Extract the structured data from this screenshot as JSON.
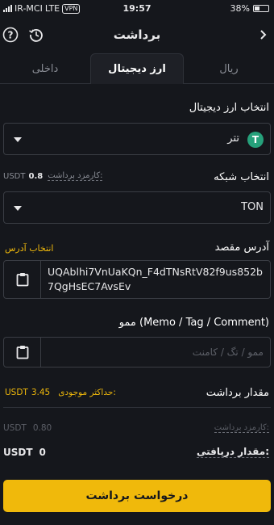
{
  "status_bar": {
    "carrier": "IR-MCI",
    "network": "LTE",
    "vpn": "VPN",
    "time": "19:57",
    "battery": "38%"
  },
  "header": {
    "title": "برداشت",
    "back_icon": "chevron-right-icon",
    "history_icon": "history-icon",
    "help_icon": "help-icon"
  },
  "tabs": [
    {
      "label": "ریال",
      "active": false
    },
    {
      "label": "ارز دیجیتال",
      "active": true
    },
    {
      "label": "داخلی",
      "active": false
    }
  ],
  "currency": {
    "label": "انتخاب ارز دیجیتال",
    "value": "تتر",
    "coin_symbol": "T"
  },
  "network": {
    "label": "انتخاب شبکه",
    "fee_label": "کارمزد برداشت:",
    "fee_value": "0.8",
    "fee_unit": "USDT",
    "value": "TON"
  },
  "address": {
    "label": "آدرس مقصد",
    "select_link": "انتخاب آدرس",
    "value": "UQAblhi7VnUaKQn_F4dTNsRtV82f9us852b7QgHsEC7AvsEv"
  },
  "memo": {
    "label": "ممو (Memo / Tag / Comment)",
    "placeholder": "ممو / تگ / کامنت"
  },
  "amount": {
    "label": "مقدار برداشت",
    "max_label": "حداکثر موجودی:",
    "max_value": "3.45",
    "max_unit": "USDT",
    "fee_label": "کارمزد برداشت:",
    "fee_value": "0.80",
    "receive_label": "مقدار دریافتی:",
    "receive_value": "0",
    "receive_unit": "USDT"
  },
  "submit_label": "درخواست برداشت",
  "colors": {
    "accent": "#f0b90b",
    "background": "#15171c",
    "tether": "#26a17b"
  }
}
